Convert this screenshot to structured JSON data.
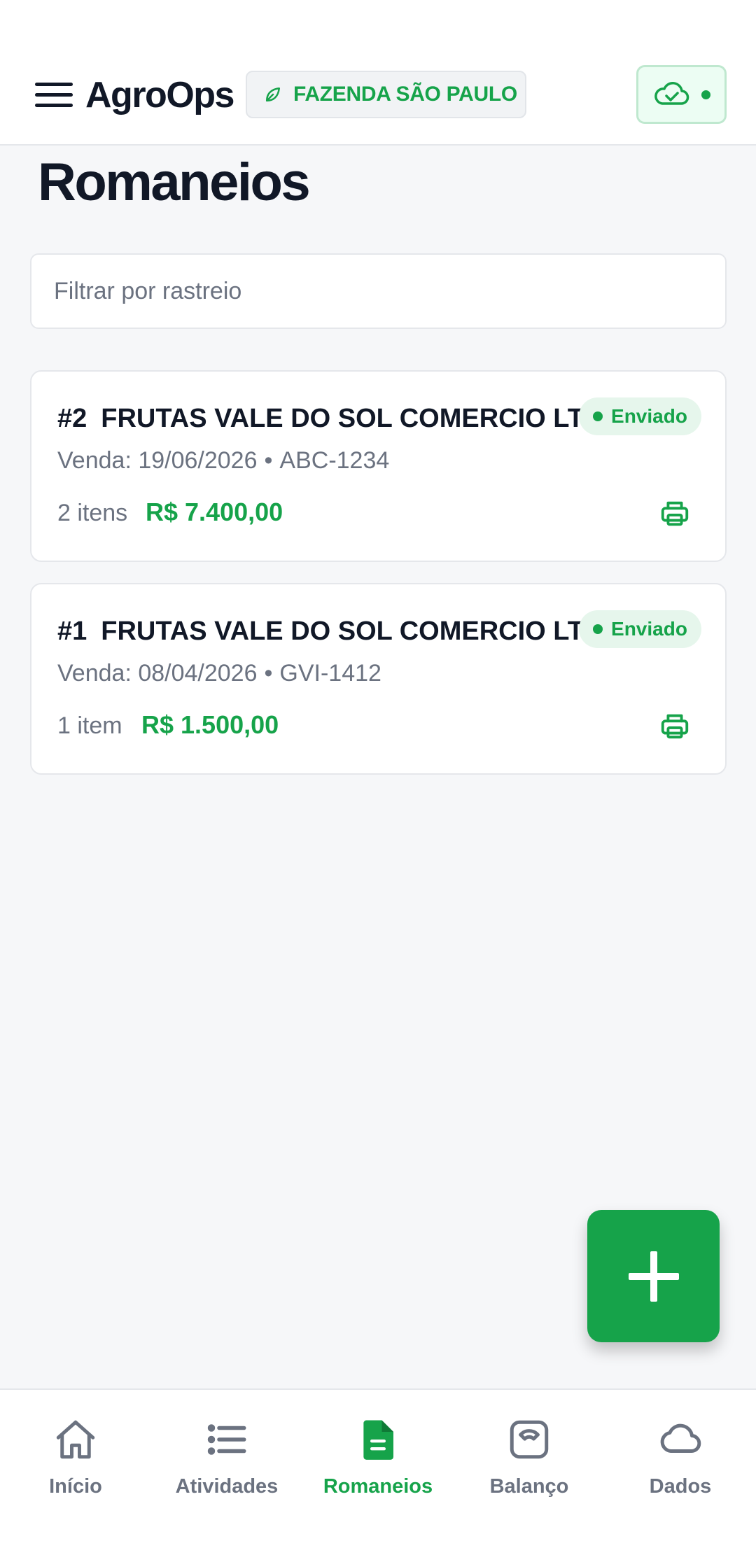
{
  "header": {
    "app_title": "AgroOps",
    "farm_name": "FAZENDA SÃO PAULO",
    "sync_status": "synced"
  },
  "page": {
    "title": "Romaneios"
  },
  "filter": {
    "placeholder": "Filtrar por rastreio",
    "value": ""
  },
  "romaneios": [
    {
      "number": "#2",
      "client": "FRUTAS VALE DO SOL COMERCIO LTDA",
      "status": "Enviado",
      "sale_label": "Venda: 19/06/2026",
      "plate": "ABC-1234",
      "separator": "•",
      "items": "2 itens",
      "total": "R$ 7.400,00"
    },
    {
      "number": "#1",
      "client": "FRUTAS VALE DO SOL COMERCIO LTDA",
      "status": "Enviado",
      "sale_label": "Venda: 08/04/2026",
      "plate": "GVI-1412",
      "separator": "•",
      "items": "1 item",
      "total": "R$ 1.500,00"
    }
  ],
  "bottom_nav": {
    "items": [
      {
        "label": "Início",
        "icon": "home-icon",
        "active": false
      },
      {
        "label": "Atividades",
        "icon": "list-icon",
        "active": false
      },
      {
        "label": "Romaneios",
        "icon": "document-icon",
        "active": true
      },
      {
        "label": "Balanço",
        "icon": "scale-icon",
        "active": false
      },
      {
        "label": "Dados",
        "icon": "cloud-icon",
        "active": false
      }
    ]
  },
  "colors": {
    "accent": "#16a34a",
    "text": "#111827",
    "muted": "#6b7280",
    "background": "#f6f7f9"
  }
}
